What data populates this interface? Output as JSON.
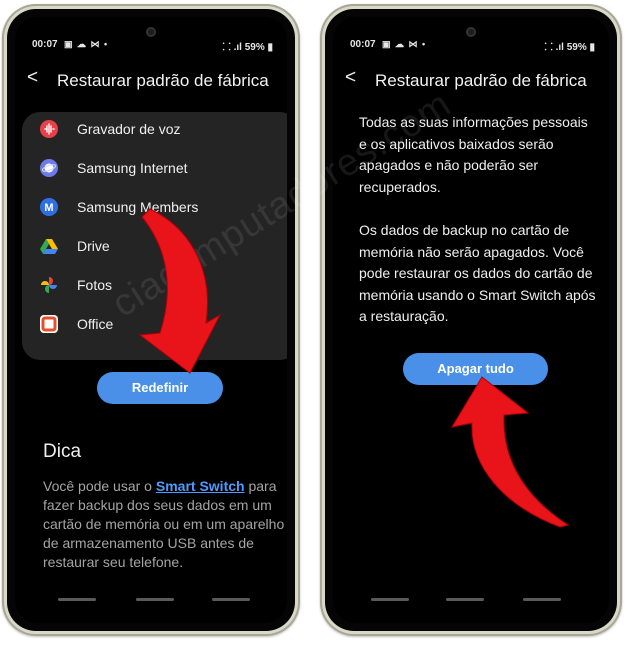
{
  "left_phone": {
    "status": {
      "time": "00:07",
      "icons": "▣ ☁ ⋈ •",
      "right": "⸬ .ıl 59% ▮"
    },
    "header": {
      "back": "<",
      "title": "Restaurar padrão de fábrica"
    },
    "apps": [
      {
        "label": "Gravador de voz",
        "icon": "voice-recorder-icon",
        "color": "#e8414a"
      },
      {
        "label": "Samsung Internet",
        "icon": "samsung-internet-icon",
        "color": "#6d7be8"
      },
      {
        "label": "Samsung Members",
        "icon": "samsung-members-icon",
        "color": "#2f6fe6"
      },
      {
        "label": "Drive",
        "icon": "google-drive-icon",
        "color": "#2ea44f"
      },
      {
        "label": "Fotos",
        "icon": "google-photos-icon",
        "color": "#f4b400"
      },
      {
        "label": "Office",
        "icon": "office-icon",
        "color": "#e5512e"
      }
    ],
    "reset_button": "Redefinir",
    "tip": {
      "title": "Dica",
      "text_before": "Você pode usar o ",
      "link": "Smart Switch",
      "text_after": " para fazer backup dos seus dados em um cartão de memória ou em um aparelho de armazenamento USB antes de restaurar seu telefone."
    }
  },
  "right_phone": {
    "status": {
      "time": "00:07",
      "icons": "▣ ☁ ⋈ •",
      "right": "⸬ .ıl 59% ▮"
    },
    "header": {
      "back": "<",
      "title": "Restaurar padrão de fábrica"
    },
    "paragraph1": "Todas as suas informações pessoais e os aplicativos baixados serão apagados e não poderão ser recuperados.",
    "paragraph2": "Os dados de backup no cartão de memória não serão apagados. Você pode restaurar os dados do cartão de memória usando o Smart Switch após a restauração.",
    "erase_button": "Apagar tudo"
  },
  "watermark": "ciacomputadores.com",
  "colors": {
    "accent": "#4a90e8",
    "arrow": "#e8141a",
    "frame": "#d9d8c9"
  }
}
